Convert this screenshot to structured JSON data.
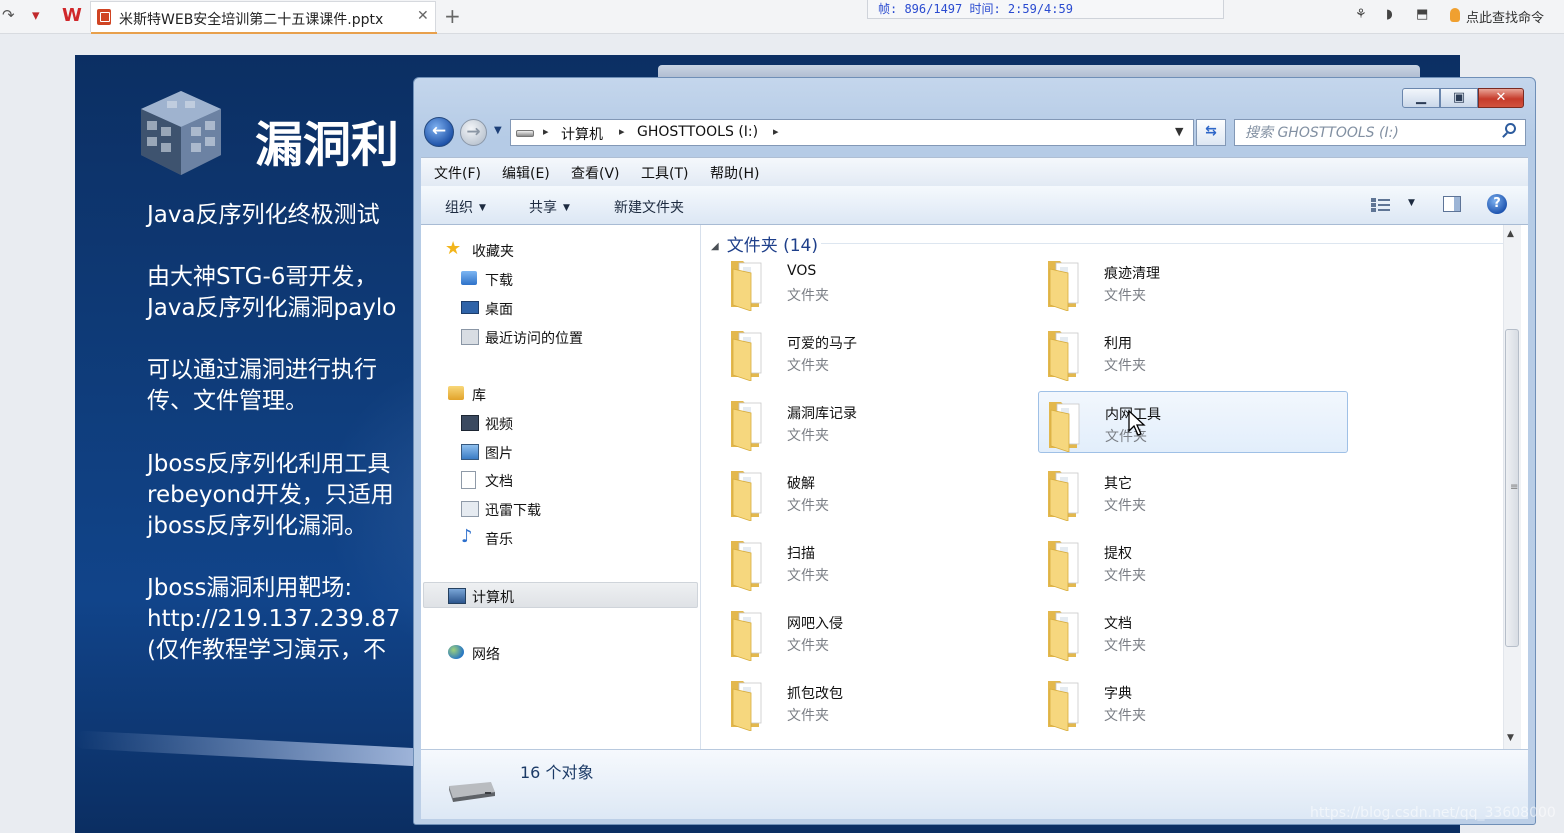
{
  "wps": {
    "tab_title": "米斯特WEB安全培训第二十五课课件.pptx",
    "tab_close": "✕",
    "new_tab": "+",
    "logo": "W",
    "hint_text": "点此查找命令"
  },
  "player": {
    "status": "帧: 896/1497 时间: 2:59/4:59"
  },
  "slide": {
    "title": "漏洞利",
    "paragraphs": [
      [
        "Java反序列化终极测试"
      ],
      [
        "由大神STG-6哥开发，",
        "Java反序列化漏洞paylo"
      ],
      [
        "可以通过漏洞进行执行",
        "传、文件管理。"
      ],
      [
        "Jboss反序列化利用工具",
        "rebeyond开发，只适用",
        "jboss反序列化漏洞。"
      ],
      [
        "Jboss漏洞利用靶场:",
        "http://219.137.239.87",
        "(仅作教程学习演示，不"
      ]
    ]
  },
  "explorer": {
    "address": {
      "crumbs": [
        "计算机",
        "GHOSTTOOLS (I:)"
      ]
    },
    "search": {
      "placeholder": "搜索 GHOSTTOOLS (I:)"
    },
    "menu": [
      "文件(F)",
      "编辑(E)",
      "查看(V)",
      "工具(T)",
      "帮助(H)"
    ],
    "commands": {
      "organize": "组织",
      "share": "共享",
      "new_folder": "新建文件夹",
      "help": "?"
    },
    "nav": {
      "favorites": "收藏夹",
      "downloads": "下载",
      "desktop": "桌面",
      "recent": "最近访问的位置",
      "libraries": "库",
      "videos": "视频",
      "pictures": "图片",
      "documents": "文档",
      "thunder": "迅雷下载",
      "music": "音乐",
      "computer": "计算机",
      "network": "网络"
    },
    "group_header": "文件夹 (14)",
    "folders": [
      {
        "name": "VOS",
        "type": "文件夹"
      },
      {
        "name": "痕迹清理",
        "type": "文件夹"
      },
      {
        "name": "可爱的马子",
        "type": "文件夹"
      },
      {
        "name": "利用",
        "type": "文件夹"
      },
      {
        "name": "漏洞库记录",
        "type": "文件夹"
      },
      {
        "name": "内网工具",
        "type": "文件夹"
      },
      {
        "name": "破解",
        "type": "文件夹"
      },
      {
        "name": "其它",
        "type": "文件夹"
      },
      {
        "name": "扫描",
        "type": "文件夹"
      },
      {
        "name": "提权",
        "type": "文件夹"
      },
      {
        "name": "网吧入侵",
        "type": "文件夹"
      },
      {
        "name": "文档",
        "type": "文件夹"
      },
      {
        "name": "抓包改包",
        "type": "文件夹"
      },
      {
        "name": "字典",
        "type": "文件夹"
      }
    ],
    "status_count": "16 个对象"
  },
  "watermark": "https://blog.csdn.net/qq_33608000",
  "colors": {
    "slide_bg": "#0f3d7c",
    "explorer_frame": "#b5cbe6",
    "group_header": "#1e3f8a",
    "close_button": "#c63b2b",
    "player_text": "#2a4bd0"
  }
}
